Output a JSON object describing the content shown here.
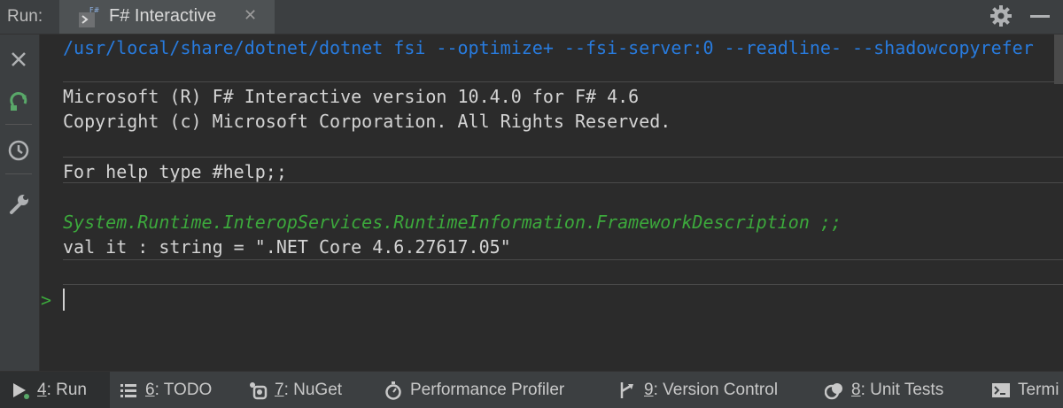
{
  "header": {
    "run_label": "Run:",
    "tab_title": "F# Interactive",
    "tab_icon_badge": "F#"
  },
  "console": {
    "command_line": "/usr/local/share/dotnet/dotnet fsi --optimize+ --fsi-server:0 --readline- --shadowcopyrefer",
    "lines": [
      "Microsoft (R) F# Interactive version 10.4.0 for F# 4.6",
      "Copyright (c) Microsoft Corporation. All Rights Reserved.",
      "For help type #help;;",
      "System.Runtime.InteropServices.RuntimeInformation.FrameworkDescription ;;",
      "val it : string = \".NET Core 4.6.27617.05\""
    ],
    "prompt": ">"
  },
  "bottom_bar": {
    "items": [
      {
        "key": "4",
        "label": ": Run",
        "icon": "run-icon"
      },
      {
        "key": "6",
        "label": ": TODO",
        "icon": "todo-list-icon"
      },
      {
        "key": "7",
        "label": ": NuGet",
        "icon": "nuget-icon"
      },
      {
        "key": "",
        "label": "Performance Profiler",
        "icon": "profiler-icon"
      },
      {
        "key": "9",
        "label": ": Version Control",
        "icon": "version-control-icon"
      },
      {
        "key": "8",
        "label": ": Unit Tests",
        "icon": "unit-tests-icon"
      },
      {
        "key": "",
        "label": "Termi",
        "icon": "terminal-icon"
      }
    ]
  },
  "colors": {
    "command": "#287bde",
    "input_echo": "#3ca93c",
    "background": "#2b2b2b",
    "panel": "#3c3f41"
  }
}
